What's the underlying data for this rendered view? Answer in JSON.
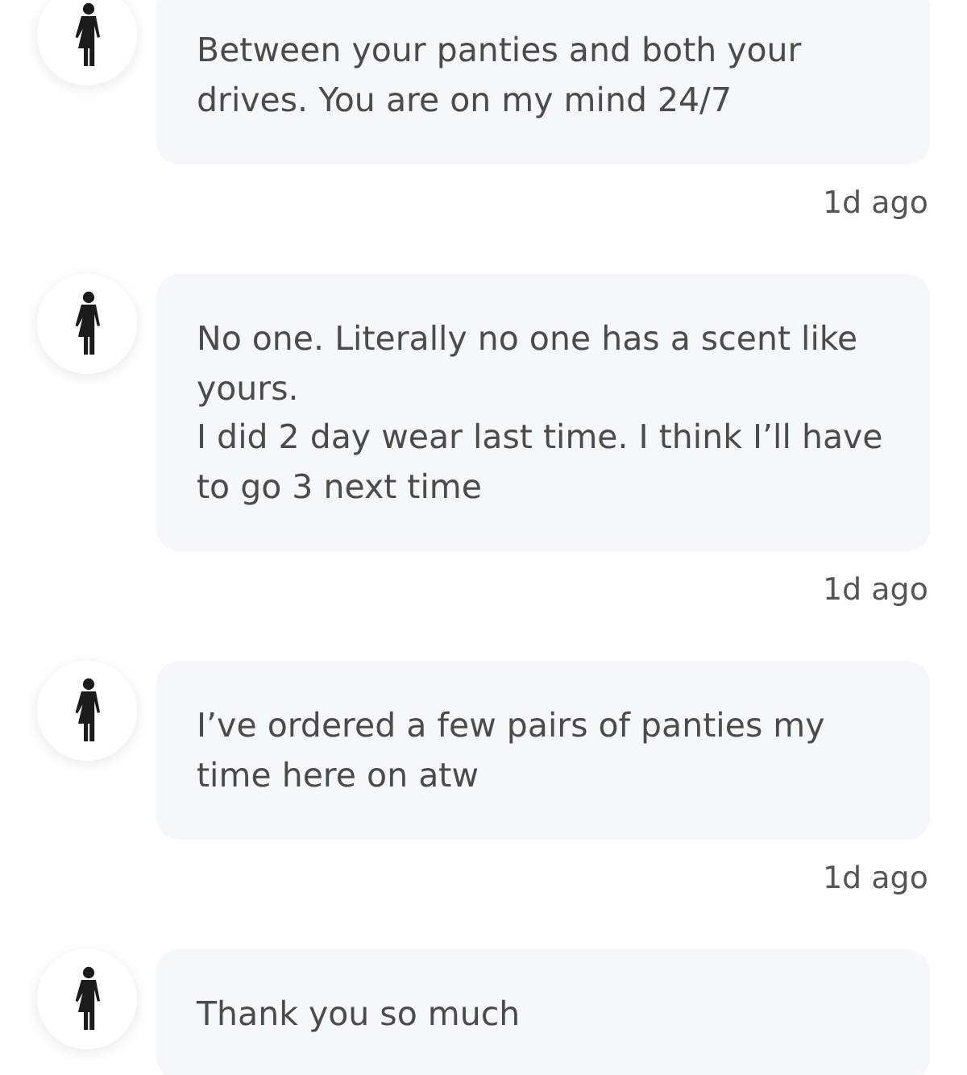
{
  "messages": [
    {
      "text": "Between your panties and both your drives. You are on my mind 24/7",
      "time": "1d ago"
    },
    {
      "text": "No one. Literally no one has a scent like yours.\nI did 2 day wear last time. I think I’ll have to go 3 next time",
      "time": "1d ago"
    },
    {
      "text": "I’ve ordered a few pairs of panties my time here on atw",
      "time": "1d ago"
    },
    {
      "text": "Thank you so much"
    }
  ]
}
